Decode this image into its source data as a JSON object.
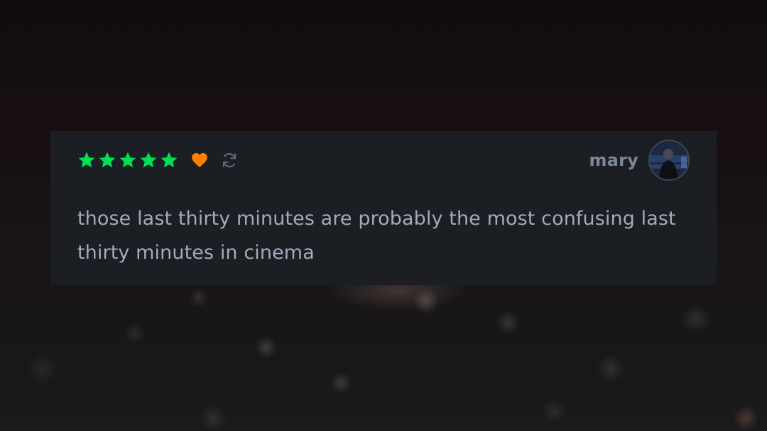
{
  "review": {
    "rating_stars": 5,
    "rating_max": 5,
    "liked": true,
    "rewatch": true,
    "username": "mary",
    "text": "those last thirty minutes are probably the most confusing last thirty minutes in cinema"
  },
  "icons": {
    "star": "star-icon",
    "like": "heart-icon",
    "rewatch": "rewatch-icon",
    "avatar": "avatar"
  },
  "colors": {
    "star": "#00e054",
    "heart": "#ff8000",
    "rewatch": "#5b6677",
    "username": "#7c8696",
    "review_text": "#a1abbb",
    "card_background": "#1b1e23"
  }
}
